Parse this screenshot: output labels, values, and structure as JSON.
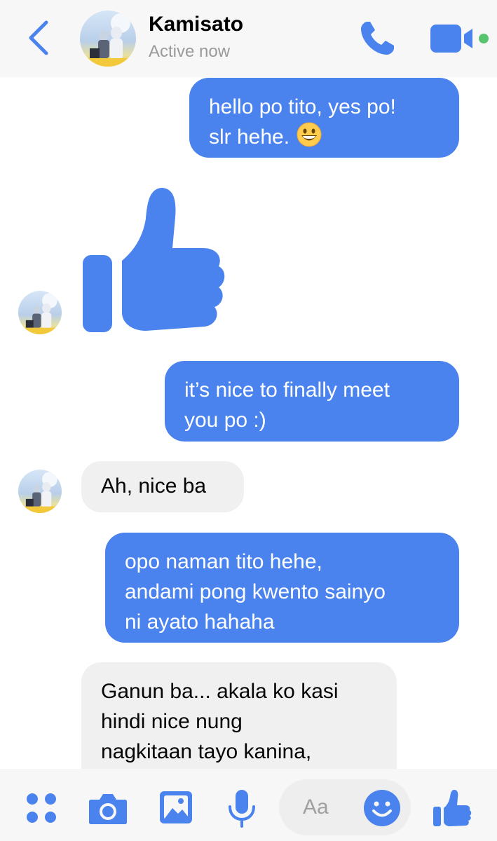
{
  "header": {
    "contact_name": "Kamisato",
    "status": "Active now"
  },
  "messages": [
    {
      "direction": "outgoing",
      "text": "hello po tito, yes po!\nslr hehe.",
      "emoji": "grinning-face"
    },
    {
      "direction": "incoming",
      "type": "like-sticker"
    },
    {
      "direction": "outgoing",
      "text": "it’s nice to finally meet\nyou po :)"
    },
    {
      "direction": "incoming",
      "text": "Ah, nice ba"
    },
    {
      "direction": "outgoing",
      "text": "opo naman tito hehe,\nandami pong kwento sainyo\nni ayato hahaha"
    },
    {
      "direction": "incoming",
      "text": "Ganun ba... akala ko kasi\nhindi nice nung\nnagkitaan tayo kanina,"
    }
  ],
  "composer": {
    "placeholder": "Aa"
  },
  "colors": {
    "accent": "#4a82ee",
    "outgoing_bubble": "#4a82ee",
    "incoming_bubble": "#f0f0f1",
    "active_dot": "#58c470"
  }
}
